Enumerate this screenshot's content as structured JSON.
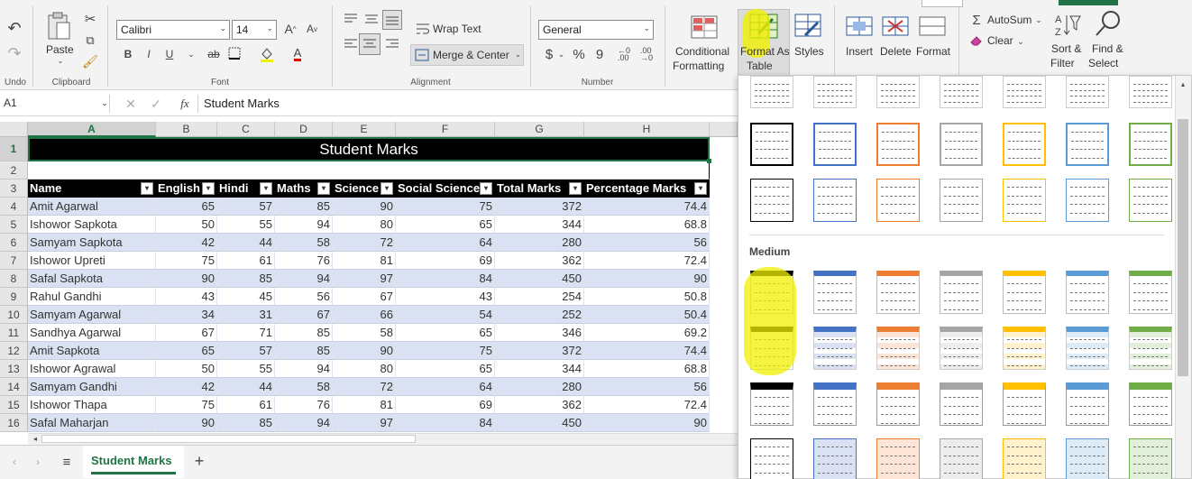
{
  "ribbon": {
    "undo": {
      "label": "Undo",
      "icon": "undo-icon"
    },
    "clipboard": {
      "paste": "Paste",
      "label": "Clipboard"
    },
    "font": {
      "name": "Calibri",
      "size": "14",
      "bold": "B",
      "italic": "I",
      "underline": "U",
      "strike": "ab",
      "label": "Font"
    },
    "alignment": {
      "wrap": "Wrap Text",
      "merge": "Merge & Center",
      "label": "Alignment"
    },
    "number": {
      "format": "General",
      "currency": "$",
      "percent": "%",
      "comma": "9",
      "label": "Number"
    },
    "styles": {
      "conditional": "Conditional",
      "conditional2": "Formatting",
      "format_table": "Format As",
      "format_table2": "Table",
      "styles": "Styles"
    },
    "cells": {
      "insert": "Insert",
      "delete": "Delete",
      "format": "Format"
    },
    "editing": {
      "autosum": "AutoSum",
      "clear": "Clear",
      "sort": "Sort &",
      "sort2": "Filter",
      "find": "Find &",
      "find2": "Select"
    }
  },
  "formula_bar": {
    "name_box": "A1",
    "fx": "fx",
    "content": "Student Marks"
  },
  "columns": [
    "A",
    "B",
    "C",
    "D",
    "E",
    "F",
    "G",
    "H"
  ],
  "rows": [
    "1",
    "2",
    "3",
    "4",
    "5",
    "6",
    "7",
    "8",
    "9",
    "10",
    "11",
    "12",
    "13",
    "14",
    "15",
    "16"
  ],
  "sheet": {
    "title": "Student Marks",
    "headers": [
      "Name",
      "English",
      "Hindi",
      "Maths",
      "Science",
      "Social Science",
      "Total Marks",
      "Percentage Marks"
    ],
    "data": [
      [
        "Amit Agarwal",
        "65",
        "57",
        "85",
        "90",
        "75",
        "372",
        "74.4"
      ],
      [
        "Ishowor Sapkota",
        "50",
        "55",
        "94",
        "80",
        "65",
        "344",
        "68.8"
      ],
      [
        "Samyam Sapkota",
        "42",
        "44",
        "58",
        "72",
        "64",
        "280",
        "56"
      ],
      [
        "Ishowor Upreti",
        "75",
        "61",
        "76",
        "81",
        "69",
        "362",
        "72.4"
      ],
      [
        "Safal Sapkota",
        "90",
        "85",
        "94",
        "97",
        "84",
        "450",
        "90"
      ],
      [
        "Rahul Gandhi",
        "43",
        "45",
        "56",
        "67",
        "43",
        "254",
        "50.8"
      ],
      [
        "Samyam Agarwal",
        "34",
        "31",
        "67",
        "66",
        "54",
        "252",
        "50.4"
      ],
      [
        "Sandhya Agarwal",
        "67",
        "71",
        "85",
        "58",
        "65",
        "346",
        "69.2"
      ],
      [
        "Amit Sapkota",
        "65",
        "57",
        "85",
        "90",
        "75",
        "372",
        "74.4"
      ],
      [
        "Ishowor Agrawal",
        "50",
        "55",
        "94",
        "80",
        "65",
        "344",
        "68.8"
      ],
      [
        "Samyam Gandhi",
        "42",
        "44",
        "58",
        "72",
        "64",
        "280",
        "56"
      ],
      [
        "Ishowor Thapa",
        "75",
        "61",
        "76",
        "81",
        "69",
        "362",
        "72.4"
      ],
      [
        "Safal Maharjan",
        "90",
        "85",
        "94",
        "97",
        "84",
        "450",
        "90"
      ]
    ]
  },
  "gallery": {
    "section_medium": "Medium"
  },
  "sheet_tabs": {
    "active": "Student Marks",
    "add": "+"
  },
  "colors": {
    "accent": "#217346",
    "band_light": "#d9e1f2",
    "highlight": "#f5f500"
  }
}
